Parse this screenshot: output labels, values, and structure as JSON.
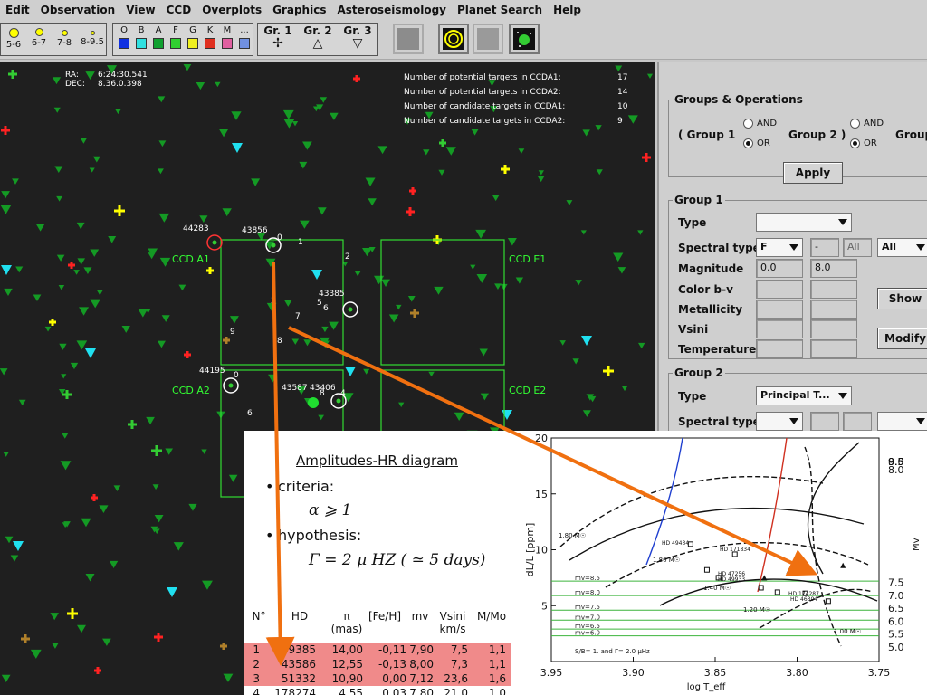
{
  "menu": [
    "Edit",
    "Observation",
    "View",
    "CCD",
    "Overplots",
    "Graphics",
    "Asteroseismology",
    "Planet Search",
    "Help"
  ],
  "toolbar": {
    "sizes": [
      "5-6",
      "6-7",
      "7-8",
      "8-9.5"
    ],
    "spectral": [
      {
        "label": "O",
        "color": "#1030e0"
      },
      {
        "label": "B",
        "color": "#30e0e0"
      },
      {
        "label": "A",
        "color": "#10a030"
      },
      {
        "label": "F",
        "color": "#30d030"
      },
      {
        "label": "G",
        "color": "#f0f020"
      },
      {
        "label": "K",
        "color": "#e03020"
      },
      {
        "label": "M",
        "color": "#e060a0"
      },
      {
        "label": "...",
        "color": "#7090e0"
      }
    ],
    "groups": [
      {
        "label": "Gr. 1",
        "symbol": "✢"
      },
      {
        "label": "Gr. 2",
        "symbol": "△"
      },
      {
        "label": "Gr. 3",
        "symbol": "▽"
      }
    ]
  },
  "sky": {
    "ra_label": "RA:",
    "ra": "6:24:30.541",
    "dec_label": "DEC:",
    "dec": "8.36.0.398",
    "counts": [
      {
        "label": "Number of potential targets in CCDA1:",
        "value": "17"
      },
      {
        "label": "Number of potential targets in CCDA2:",
        "value": "14"
      },
      {
        "label": "Number of candidate targets in CCDA1:",
        "value": "10"
      },
      {
        "label": "Number of candidate targets in CCDA2:",
        "value": "9"
      }
    ],
    "ccd": {
      "a1": "CCD A1",
      "a2": "CCD A2",
      "e1": "CCD E1",
      "e2": "CCD E2"
    },
    "star_ids": [
      "44283",
      "43856",
      "44195",
      "43587",
      "43406",
      "43385"
    ],
    "numbers": [
      "0",
      "1",
      "2",
      "3",
      "4",
      "5",
      "6",
      "7",
      "8",
      "9"
    ]
  },
  "panel": {
    "groups_ops": "Groups & Operations",
    "group1_paren": "( Group 1",
    "group2_paren": "Group 2 )",
    "group_trunc": "Group",
    "and": "AND",
    "or": "OR",
    "apply": "Apply",
    "g1": {
      "title": "Group 1",
      "type": "Type",
      "spectral_type": "Spectral type",
      "spec_from": "F",
      "spec_dash": "-",
      "spec_to": "All",
      "spec_all": "All",
      "magnitude": "Magnitude",
      "mag_min": "0.0",
      "mag_max": "8.0",
      "color": "Color b-v",
      "metallicity": "Metallicity",
      "vsini": "Vsini",
      "temperature": "Temperature",
      "show": "Show",
      "modify": "Modify"
    },
    "g2": {
      "title": "Group 2",
      "type": "Type",
      "type_value": "Principal T...",
      "spectral_type": "Spectral type"
    }
  },
  "slide": {
    "title": "Amplitudes-HR diagram",
    "criteria": "criteria:",
    "criteria_formula": "α ⩾ 1",
    "hypothesis": "hypothesis:",
    "hypothesis_formula": "Γ = 2 μ HZ ( ≃ 5   days)",
    "table": {
      "headers": [
        "N°",
        "HD",
        "π\n(mas)",
        "[Fe/H]",
        "mv",
        "Vsini\nkm/s",
        "M/Mo"
      ],
      "rows": [
        [
          "1",
          "49385",
          "14,00",
          "-0,11",
          "7,90",
          "7,5",
          "1,1"
        ],
        [
          "2",
          "43586",
          "12,55",
          "-0,13",
          "8,00",
          "7,3",
          "1,1"
        ],
        [
          "3",
          "51332",
          "10,90",
          "0,00",
          "7,12",
          "23,6",
          "1,6"
        ],
        [
          "4",
          "178274",
          "4,55",
          "0,03",
          "7,80",
          "21,0",
          "1,0"
        ]
      ]
    }
  },
  "chart_data": {
    "type": "scatter",
    "xlabel": "log T_eff",
    "ylabel": "dL/L [ppm]",
    "right_label": "Mv",
    "xlim": [
      3.95,
      3.75
    ],
    "ylim": [
      0,
      20
    ],
    "x_ticks": [
      "3.95",
      "3.90",
      "3.85",
      "3.80",
      "3.75"
    ],
    "y_ticks": [
      "5",
      "10",
      "15",
      "20"
    ],
    "right_ticks": [
      "5.0",
      "5.5",
      "6.0",
      "6.5",
      "7.0",
      "7.5",
      "8.0",
      "8.5",
      "9.0",
      "9.5"
    ],
    "mv_lines": [
      {
        "label": "mv=8.5",
        "y": 7.2
      },
      {
        "label": "mv=8.0",
        "y": 5.9
      },
      {
        "label": "mv=7.5",
        "y": 4.6
      },
      {
        "label": "mv=7.0",
        "y": 3.7
      },
      {
        "label": "mv=6.5",
        "y": 2.9
      },
      {
        "label": "mv=6.0",
        "y": 2.3
      }
    ],
    "mass_labels": [
      "1.80 M☉",
      "1.80 M☉",
      "1.40 M☉",
      "1.20 M☉",
      "1.00 M☉"
    ],
    "star_labels": [
      "HD 49434",
      "HD 171834",
      "HD 47256",
      "HD 49933",
      "HD 174287",
      "HD 46304"
    ],
    "note": "S/B= 1. and Γ= 2.0 μHz",
    "colors": {
      "mv_line": "#3cb43c",
      "track_blue": "#2040d0",
      "track_red": "#d03020"
    }
  },
  "colors": {
    "sky_bg": "#1f1f1f",
    "ccd": "#33dd33",
    "arrow": "#f07010",
    "table_row": "#f08a8a"
  }
}
